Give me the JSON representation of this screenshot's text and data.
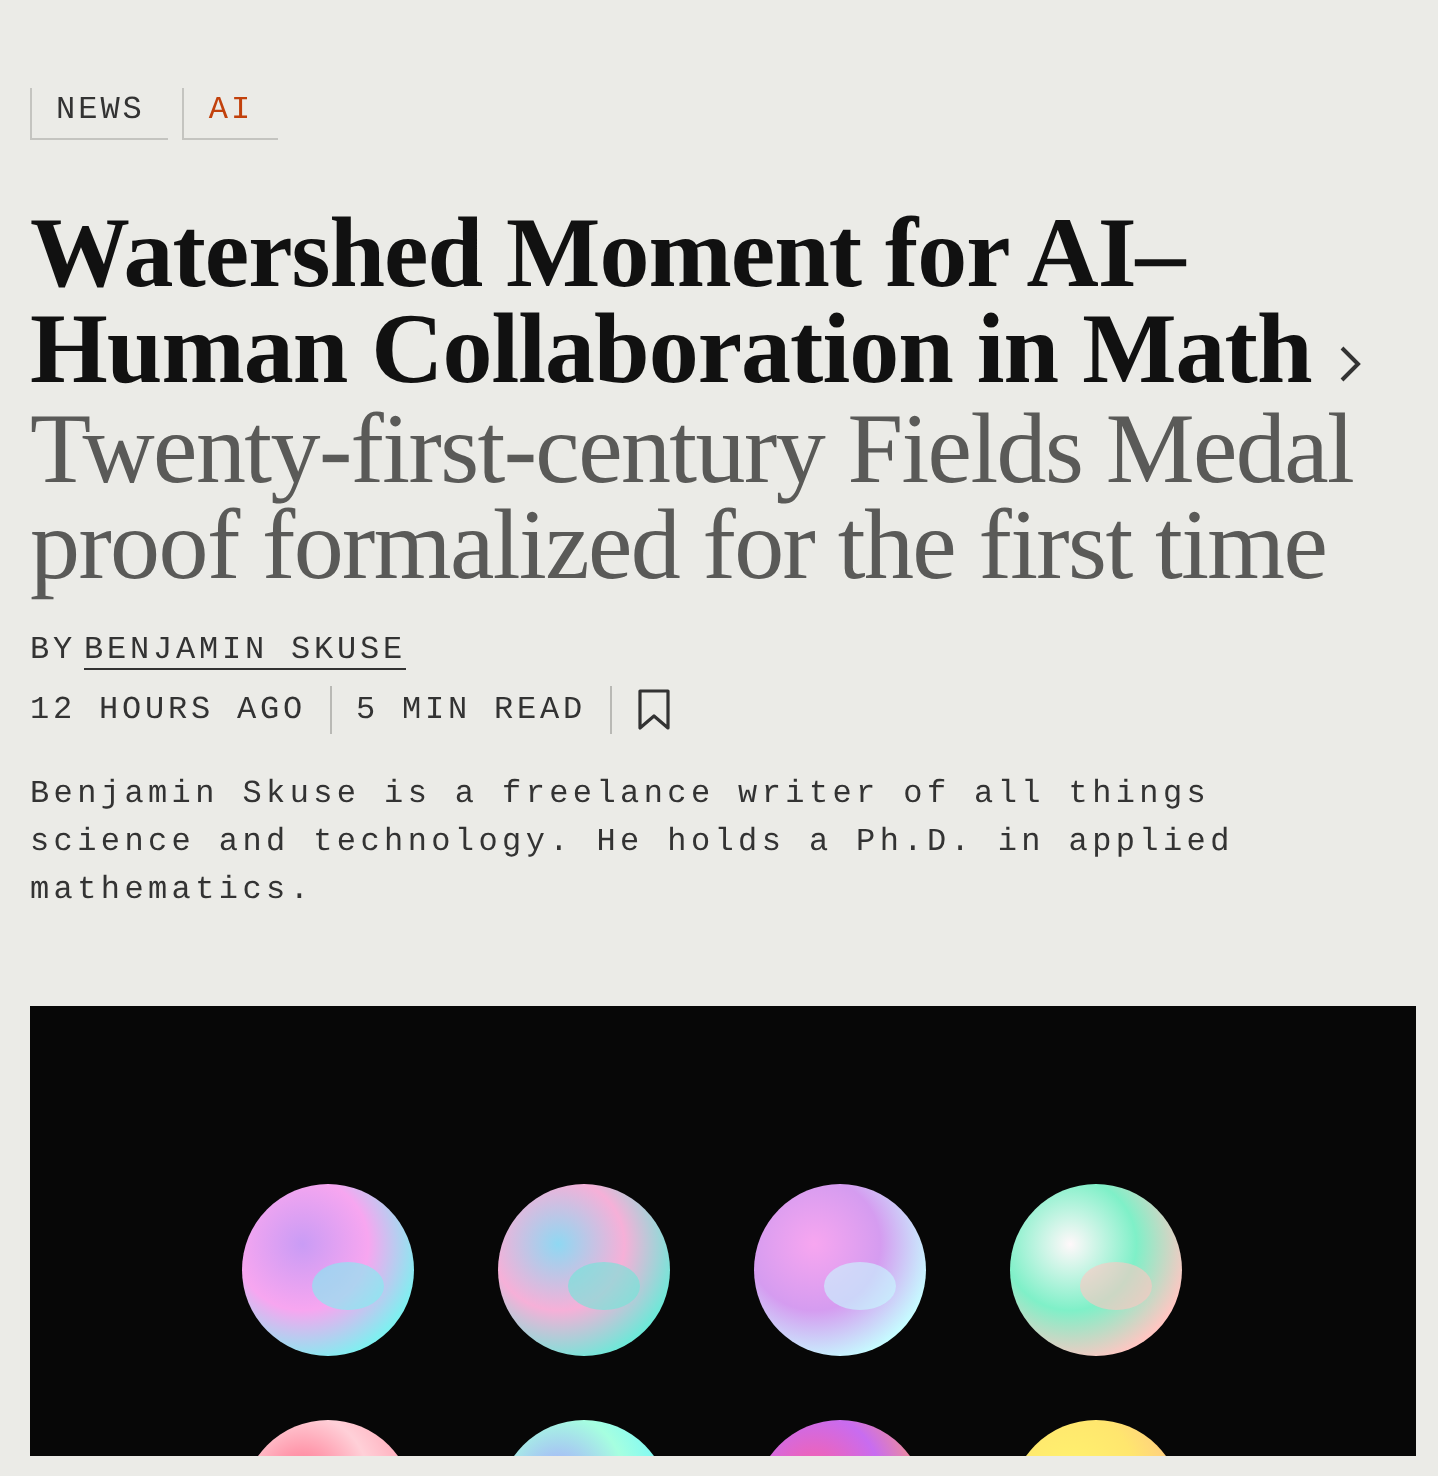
{
  "tags": [
    {
      "label": "NEWS",
      "kind": "section"
    },
    {
      "label": "AI",
      "kind": "topic"
    }
  ],
  "headline": "Watershed Moment for AI–Human Collaboration in Math",
  "subtitle": "Twenty-first-century Fields Medal proof formalized for the first time",
  "byline": {
    "prefix": "BY",
    "author": "BENJAMIN SKUSE"
  },
  "meta": [
    "12 HOURS AGO",
    "5 MIN READ"
  ],
  "bio": "Benjamin Skuse is a freelance writer of all things science and technology. He holds a Ph.D. in applied mathematics."
}
